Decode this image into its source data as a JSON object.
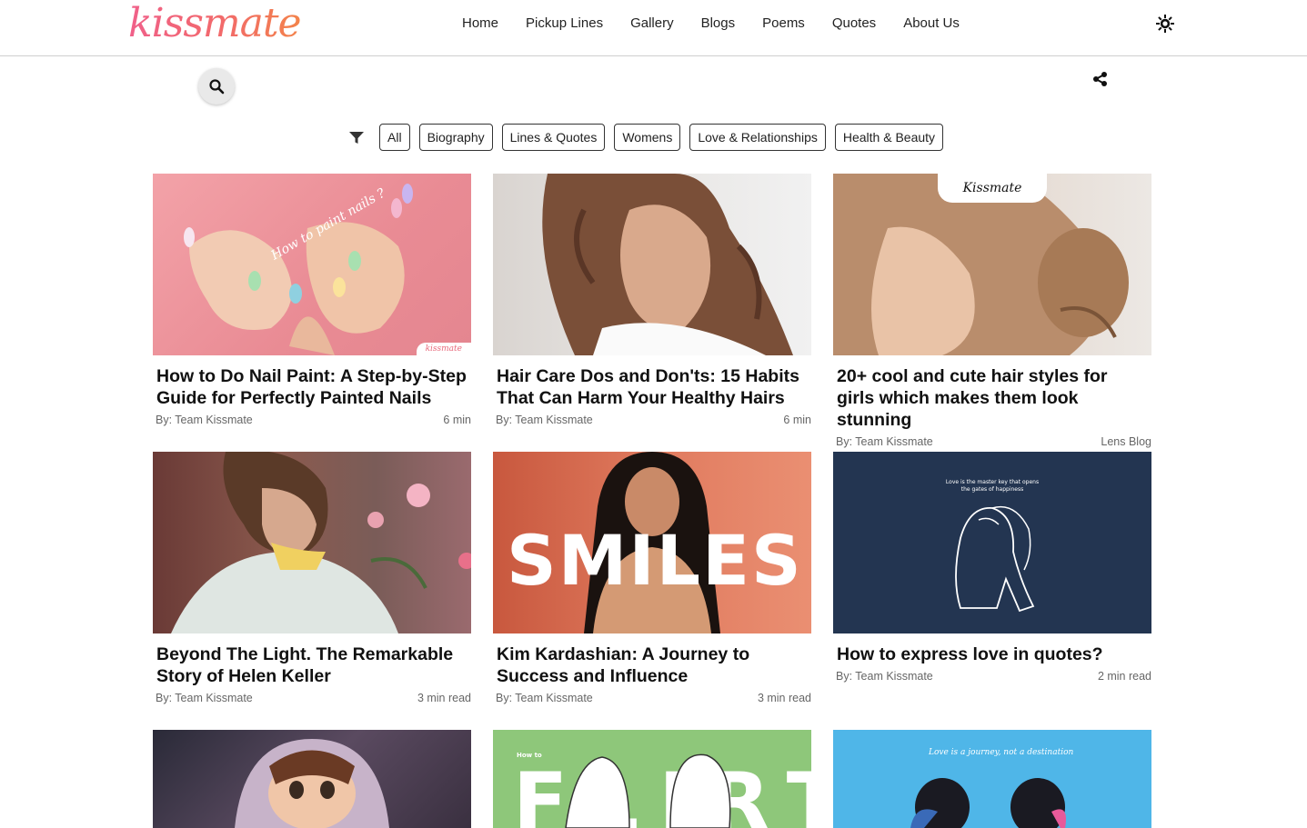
{
  "header": {
    "logo_text": "kissmate",
    "nav": [
      "Home",
      "Pickup Lines",
      "Gallery",
      "Blogs",
      "Poems",
      "Quotes",
      "About Us"
    ]
  },
  "filters": {
    "chips": [
      "All",
      "Biography",
      "Lines & Quotes",
      "Womens",
      "Love & Relationships",
      "Health & Beauty"
    ]
  },
  "cards": [
    {
      "title": "How to Do Nail Paint: A Step-by-Step Guide for Perfectly Painted Nails",
      "author": "By: Team Kissmate",
      "read": "6 min",
      "image_text": "How to paint nails ?",
      "badge": "kissmate"
    },
    {
      "title": "Hair Care Dos and Don'ts: 15 Habits That Can Harm Your Healthy Hairs",
      "author": "By: Team Kissmate",
      "read": "6 min"
    },
    {
      "title": "20+ cool and cute hair styles for girls which makes them look stunning",
      "author": "By: Team Kissmate",
      "read": "Lens Blog",
      "badge": "Kissmate"
    },
    {
      "title": "Beyond The Light. The Remarkable Story of Helen Keller",
      "author": "By: Team Kissmate",
      "read": "3 min read"
    },
    {
      "title": "Kim Kardashian: A Journey to Success and Influence",
      "author": "By: Team Kissmate",
      "read": "3 min read",
      "image_text": "SMILES"
    },
    {
      "title": "How to express love in quotes?",
      "author": "By: Team Kissmate",
      "read": "2 min read",
      "image_text": "Love is the master key that opens the gates of happiness"
    },
    {
      "title": "",
      "author": "",
      "read": ""
    },
    {
      "title": "",
      "author": "",
      "read": "",
      "image_text": "FLIRT",
      "image_subtext": "How to"
    },
    {
      "title": "",
      "author": "",
      "read": "",
      "image_text": "Love is a journey, not a destination"
    }
  ]
}
